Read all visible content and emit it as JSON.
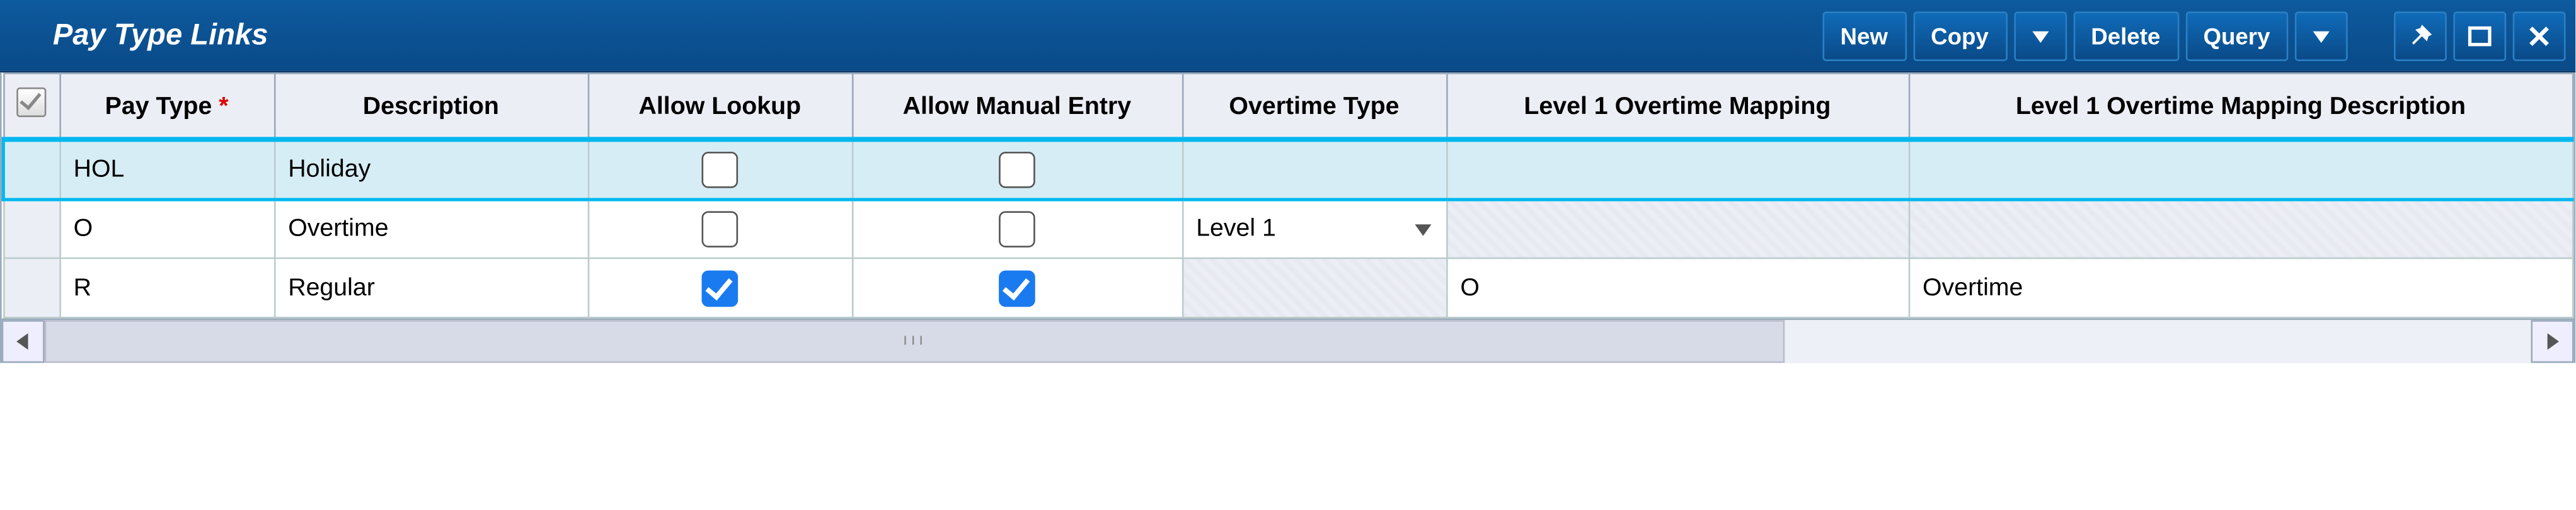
{
  "header": {
    "title": "Pay Type Links",
    "buttons": {
      "new": "New",
      "copy": "Copy",
      "delete": "Delete",
      "query": "Query"
    }
  },
  "table": {
    "columns": {
      "pay_type": "Pay Type",
      "description": "Description",
      "allow_lookup": "Allow Lookup",
      "allow_manual_entry": "Allow Manual Entry",
      "overtime_type": "Overtime Type",
      "l1_mapping": "Level 1 Overtime Mapping",
      "l1_mapping_desc": "Level 1 Overtime Mapping Description"
    },
    "rows": [
      {
        "selected": true,
        "pay_type": "HOL",
        "description": "Holiday",
        "allow_lookup": false,
        "allow_manual_entry": false,
        "overtime_type": "",
        "l1_mapping": "",
        "l1_mapping_desc": ""
      },
      {
        "selected": false,
        "pay_type": "O",
        "description": "Overtime",
        "allow_lookup": false,
        "allow_manual_entry": false,
        "overtime_type": "Level 1",
        "l1_mapping": "",
        "l1_mapping_desc": ""
      },
      {
        "selected": false,
        "pay_type": "R",
        "description": "Regular",
        "allow_lookup": true,
        "allow_manual_entry": true,
        "overtime_type": "",
        "l1_mapping": "O",
        "l1_mapping_desc": "Overtime"
      }
    ]
  }
}
